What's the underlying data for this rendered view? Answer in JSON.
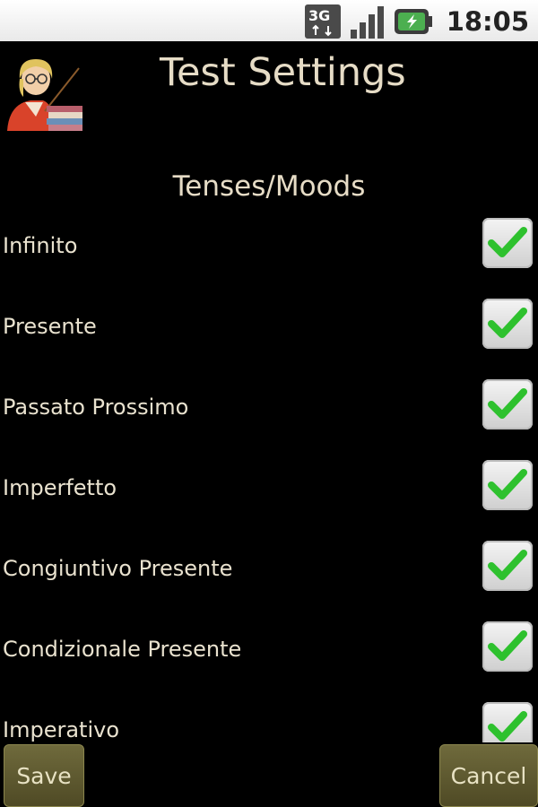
{
  "status_bar": {
    "network_type": "3G",
    "time": "18:05"
  },
  "header": {
    "title": "Test Settings",
    "app_icon": "teacher-icon"
  },
  "section": {
    "title": "Tenses/Moods"
  },
  "options": [
    {
      "label": "Infinito",
      "checked": true
    },
    {
      "label": "Presente",
      "checked": true
    },
    {
      "label": "Passato Prossimo",
      "checked": true
    },
    {
      "label": "Imperfetto",
      "checked": true
    },
    {
      "label": "Congiuntivo Presente",
      "checked": true
    },
    {
      "label": "Condizionale Presente",
      "checked": true
    },
    {
      "label": "Imperativo",
      "checked": true
    }
  ],
  "buttons": {
    "save": "Save",
    "cancel": "Cancel"
  },
  "colors": {
    "background": "#000000",
    "text": "#e6dcc6",
    "check": "#2ec12e",
    "button": "#5e5930"
  }
}
